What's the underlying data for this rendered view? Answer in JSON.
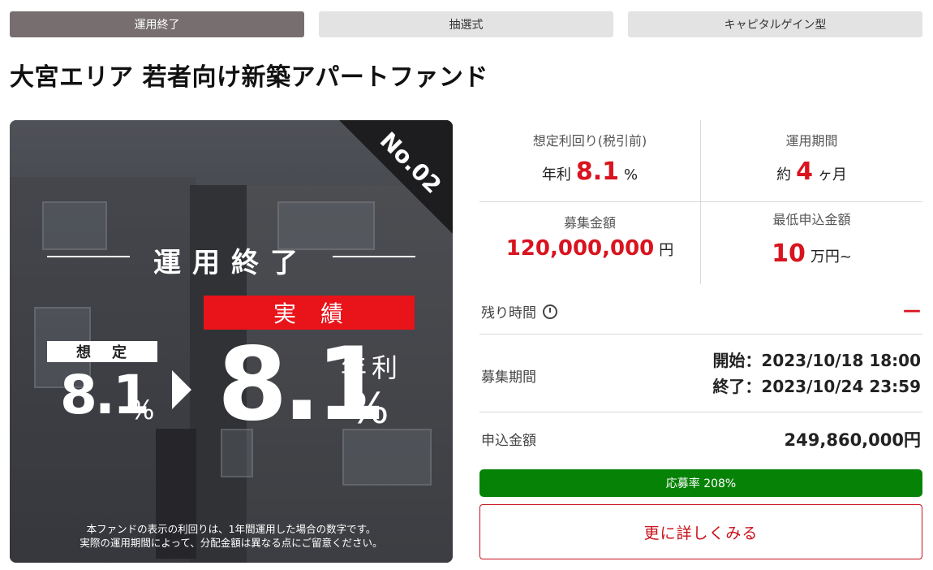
{
  "tags": [
    "運用終了",
    "抽選式",
    "キャピタルゲイン型"
  ],
  "title": "大宮エリア 若者向け新築アパートファンド",
  "hero": {
    "ribbon": "No.02",
    "status": "運用終了",
    "jisseki": "実績",
    "sotei": "想定",
    "sotei_value": "8.1",
    "sotei_pct": "%",
    "big_value": "8.1",
    "nenri": "年利",
    "big_pct": "%",
    "note_line1": "本ファンドの表示の利回りは、1年間運用した場合の数字です。",
    "note_line2": "実際の運用期間によって、分配金額は異なる点にご留意ください。"
  },
  "stats": {
    "yield": {
      "label": "想定利回り(税引前)",
      "prefix": "年利",
      "value": "8.1",
      "suffix": "%"
    },
    "period": {
      "label": "運用期間",
      "prefix": "約",
      "value": "4",
      "suffix": "ヶ月"
    },
    "raise": {
      "label": "募集金額",
      "value": "120,000,000",
      "suffix": "円"
    },
    "minimum": {
      "label": "最低申込金額",
      "value": "10",
      "suffix": "万円~"
    }
  },
  "remaining": {
    "label": "残り時間",
    "value": "—"
  },
  "recruitment": {
    "label": "募集期間",
    "start": "開始：2023/10/18 18:00",
    "end": "終了：2023/10/24 23:59"
  },
  "applied": {
    "label": "申込金額",
    "value": "249,860,000円"
  },
  "progress": {
    "label": "応募率 208%",
    "percent": 208
  },
  "more_button": "更に詳しくみる",
  "colors": {
    "accent_red": "#d8141f",
    "progress_green": "#068206",
    "tag_active": "#776f6f"
  }
}
